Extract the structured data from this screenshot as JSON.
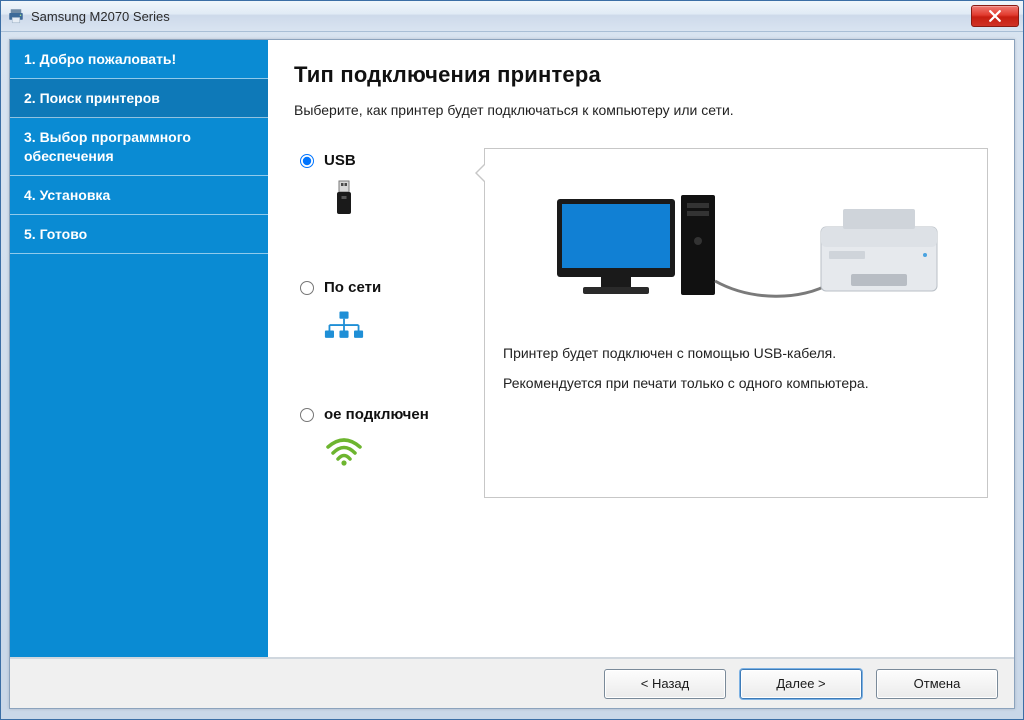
{
  "window": {
    "title": "Samsung M2070 Series"
  },
  "sidebar": {
    "steps": [
      "1. Добро пожаловать!",
      "2. Поиск принтеров",
      "3. Выбор программного обеспечения",
      "4. Установка",
      "5. Готово"
    ],
    "active_index": 1
  },
  "main": {
    "heading": "Тип подключения принтера",
    "subtitle": "Выберите, как принтер будет подключаться к компьютеру или сети.",
    "options": {
      "usb": {
        "label": "USB",
        "selected": true
      },
      "network": {
        "label": "По сети",
        "selected": false
      },
      "wireless": {
        "label": "ое подключен",
        "selected": false
      }
    },
    "detail": {
      "line1": "Принтер будет подключен с помощью USB-кабеля.",
      "line2": "Рекомендуется при печати только с одного компьютера."
    }
  },
  "buttons": {
    "back": "< Назад",
    "next": "Далее >",
    "cancel": "Отмена"
  }
}
